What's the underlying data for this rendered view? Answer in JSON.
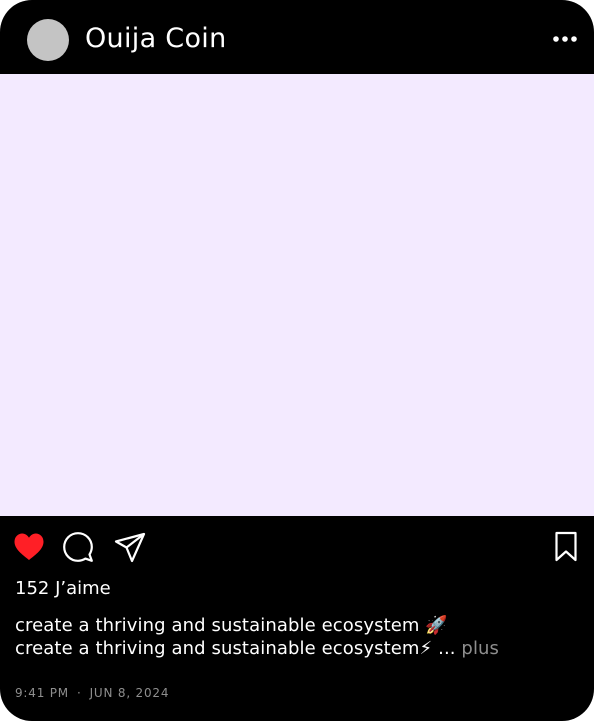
{
  "post": {
    "account_name": "Ouija Coin",
    "likes_text": "152 J’aime",
    "caption_line1": "create a thriving and sustainable ecosystem",
    "caption_emoji1": "🚀",
    "caption_line2": "create a thriving and sustainable ecosystem",
    "caption_emoji2": "⚡",
    "ellipsis": "...",
    "more_label": "plus",
    "time": "9:41 PM",
    "separator": "·",
    "date": "JUN 8, 2024"
  },
  "icons": {
    "more": "more-dots-icon",
    "like": "heart-icon",
    "comment": "comment-icon",
    "share": "paper-plane-icon",
    "save": "bookmark-icon"
  },
  "colors": {
    "card_background": "#000000",
    "image_background": "#f3eaff",
    "avatar": "#c4c4c4",
    "liked_heart": "#ff1f26",
    "muted_text": "#8e8e8e"
  }
}
